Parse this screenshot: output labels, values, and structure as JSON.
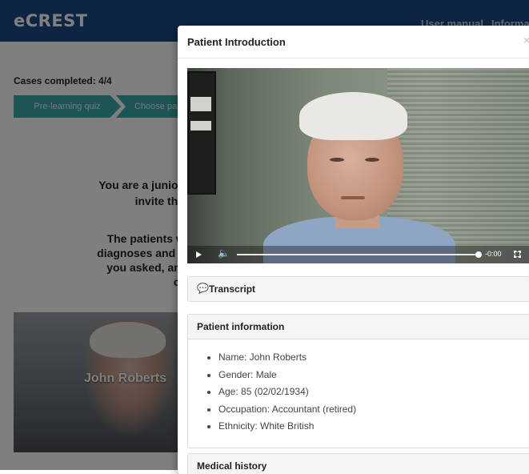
{
  "app": {
    "brand": "eCREST",
    "nav": [
      "User manual",
      "Information"
    ]
  },
  "progress": {
    "cases_completed": "Cases completed: 4/4",
    "steps": [
      "Pre-learning quiz",
      "Choose patient"
    ]
  },
  "intro": {
    "line1": "You are a junior doctor on rota",
    "line2": "invite them in for",
    "line3": "The patients will first explai",
    "line4": "diagnoses and decide on how t",
    "line5": "you asked, and feedback or",
    "line6": "co"
  },
  "patient_card": {
    "name": "John Roberts"
  },
  "modal": {
    "title": "Patient Introduction",
    "close_glyph": "×",
    "video": {
      "time": "-0:00",
      "progress": 1.0
    },
    "transcript": {
      "label": "Transcript",
      "icon": "comment-icon"
    },
    "patient_info": {
      "heading": "Patient information",
      "items": [
        "Name: John Roberts",
        "Gender: Male",
        "Age: 85 (02/02/1934)",
        "Occupation: Accountant (retired)",
        "Ethnicity: White British"
      ]
    },
    "medical_history": {
      "heading": "Medical history"
    }
  },
  "colors": {
    "navbar": "#1a4a86",
    "step": "#3aa9a9",
    "backdrop": "rgba(0,0,0,0.5)"
  }
}
